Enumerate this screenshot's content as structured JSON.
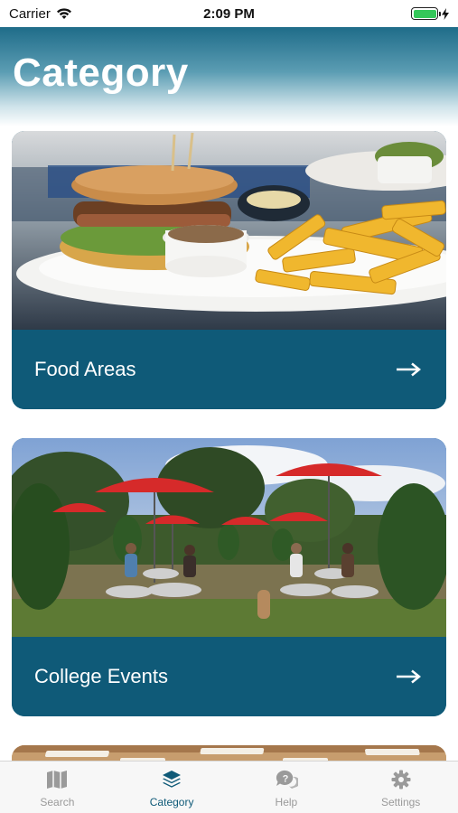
{
  "status_bar": {
    "carrier": "Carrier",
    "time": "2:09 PM",
    "battery_level": 1.0
  },
  "header": {
    "title": "Category"
  },
  "cards": [
    {
      "label": "Food Areas",
      "image": "burger-and-fries-photo",
      "arrow_icon": "arrow-right-icon"
    },
    {
      "label": "College Events",
      "image": "outdoor-patio-with-red-umbrellas-photo",
      "arrow_icon": "arrow-right-icon"
    },
    {
      "label": "",
      "image": "indoor-ceiling-photo"
    }
  ],
  "tab_bar": {
    "tabs": [
      {
        "label": "Search",
        "icon": "map-icon",
        "active": false
      },
      {
        "label": "Category",
        "icon": "layers-icon",
        "active": true
      },
      {
        "label": "Help",
        "icon": "help-bubble-icon",
        "active": false
      },
      {
        "label": "Settings",
        "icon": "gear-icon",
        "active": false
      }
    ]
  },
  "colors": {
    "accent": "#0f5a78",
    "inactive_tab": "#9a9a9a",
    "battery": "#34c759"
  }
}
